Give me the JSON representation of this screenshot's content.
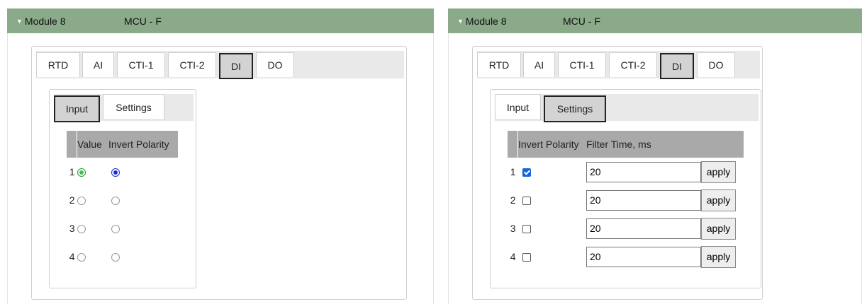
{
  "panels": [
    {
      "module": "Module 8",
      "mcu": "MCU - F",
      "tabs": [
        "RTD",
        "AI",
        "CTI-1",
        "CTI-2",
        "DI",
        "DO"
      ],
      "active_tab": "DI",
      "subtabs": [
        "Input",
        "Settings"
      ],
      "active_subtab": "Input",
      "columns": [
        "Value",
        "Invert Polarity"
      ],
      "rows": [
        {
          "num": "1",
          "value": true,
          "invert": true
        },
        {
          "num": "2",
          "value": false,
          "invert": false
        },
        {
          "num": "3",
          "value": false,
          "invert": false
        },
        {
          "num": "4",
          "value": false,
          "invert": false
        }
      ]
    },
    {
      "module": "Module 8",
      "mcu": "MCU - F",
      "tabs": [
        "RTD",
        "AI",
        "CTI-1",
        "CTI-2",
        "DI",
        "DO"
      ],
      "active_tab": "DI",
      "subtabs": [
        "Input",
        "Settings"
      ],
      "active_subtab": "Settings",
      "columns": [
        "Invert Polarity",
        "Filter Time, ms"
      ],
      "apply_label": "apply",
      "rows": [
        {
          "num": "1",
          "invert": true,
          "filter": "20"
        },
        {
          "num": "2",
          "invert": false,
          "filter": "20"
        },
        {
          "num": "3",
          "invert": false,
          "filter": "20"
        },
        {
          "num": "4",
          "invert": false,
          "filter": "20"
        }
      ]
    }
  ],
  "colors": {
    "header_bg": "#8aaa8a",
    "value_on": "#3cc24a",
    "invert_on": "#1730d0",
    "checkbox_on": "#1565e0"
  },
  "icons": {
    "collapse": "caret-down-icon"
  }
}
